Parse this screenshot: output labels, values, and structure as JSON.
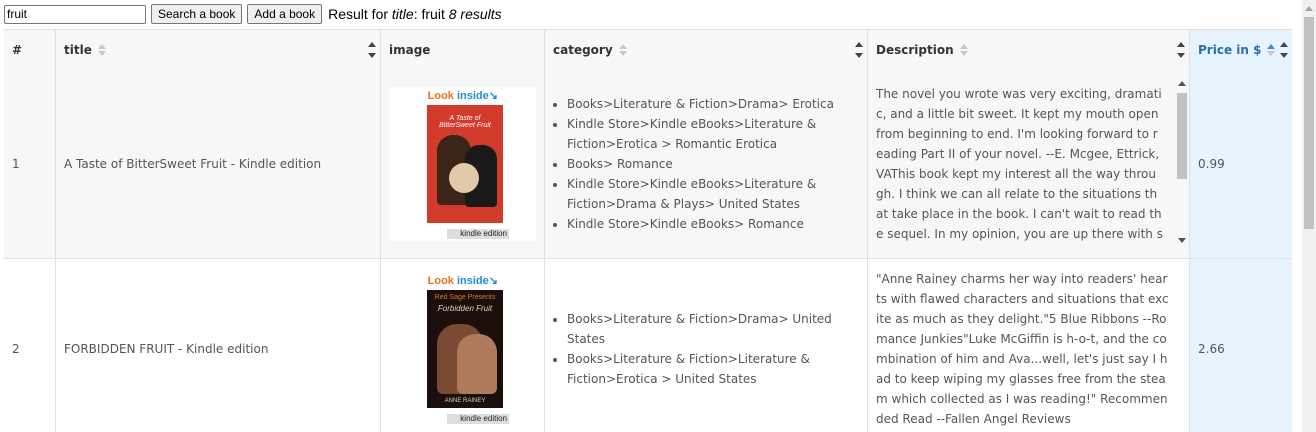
{
  "search": {
    "value": "fruit",
    "search_button": "Search a book",
    "add_button": "Add a book"
  },
  "result": {
    "prefix": "Result for",
    "field": "title",
    "sep": ": fruit",
    "count": "8 results"
  },
  "headers": {
    "num": "#",
    "title": "title",
    "image": "image",
    "category": "category",
    "description": "Description",
    "price": "Price in $"
  },
  "rows": [
    {
      "num": "1",
      "title": "A Taste of BitterSweet Fruit - Kindle edition",
      "image": {
        "look": "Look",
        "inside": "inside",
        "cover_title": "A Taste of BitterSweet Fruit",
        "kindle": "kindle edition"
      },
      "categories": [
        "Books>Literature & Fiction>Drama> Erotica",
        "Kindle Store>Kindle eBooks>Literature & Fiction>Erotica > Romantic Erotica",
        "Books> Romance",
        "Kindle Store>Kindle eBooks>Literature & Fiction>Drama & Plays> United States",
        "Kindle Store>Kindle eBooks> Romance"
      ],
      "description": "The novel you wrote was very exciting, dramatic, and a little bit sweet. It kept my mouth open from beginning to end. I'm looking forward to reading Part II of your novel. --E. Mcgee, Ettrick, VAThis book kept my interest all the way through. I think we can all relate to the situations that take place in the book. I can't wait to read the sequel. In my opinion, you are up there with some of the best authors, (Eric Jerome Dickey, Nikki Turner, Terry McMillian, etc.)",
      "price": "0.99"
    },
    {
      "num": "2",
      "title": "FORBIDDEN FRUIT - Kindle edition",
      "image": {
        "look": "Look",
        "inside": "inside",
        "cover_pub": "Red Sage Presents",
        "cover_title": "Forbidden Fruit",
        "cover_author": "ANNE RAINEY",
        "kindle": "kindle edition"
      },
      "categories": [
        "Books>Literature & Fiction>Drama> United States",
        "Books>Literature & Fiction>Literature & Fiction>Erotica > United States"
      ],
      "description": "\"Anne Rainey charms her way into readers' hearts with flawed characters and situations that excite as much as they delight.\"5 Blue Ribbons  --Romance Junkies\"Luke McGiffin is h-o-t, and the combination of him and Ava...well, let's just say I had to keep wiping my glasses free from the steam which collected as I was reading!\" Recommended Read --Fallen Angel Reviews",
      "price": "2.66"
    }
  ]
}
